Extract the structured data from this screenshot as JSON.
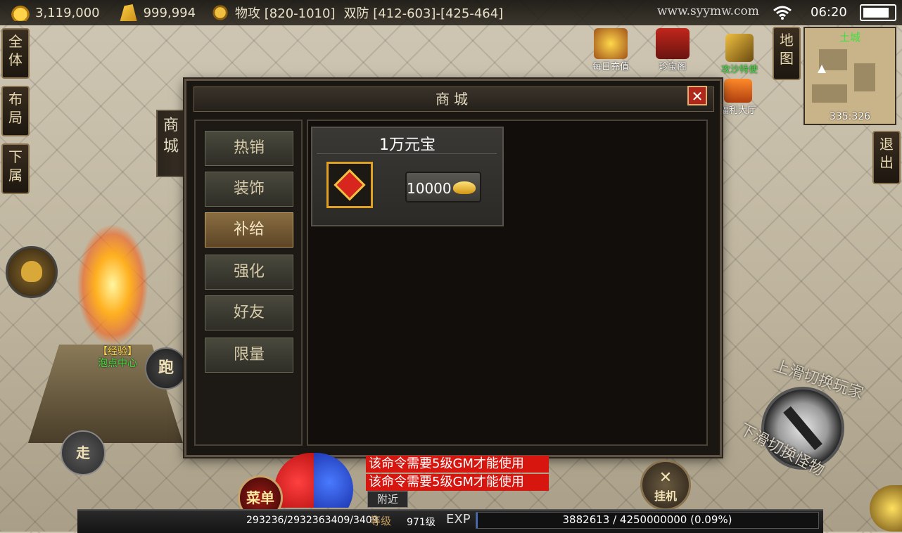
{
  "status_bar": {
    "gold": "3,119,000",
    "ingot": "999,994",
    "attack": "物攻 [820-1010]",
    "defense": "双防 [412-603]-[425-464]",
    "site": "www.syymw.com",
    "time": "06:20"
  },
  "left_buttons": {
    "all": "全体",
    "layout": "布局",
    "subordinate": "下属"
  },
  "events": {
    "daily_recharge": "每日充值",
    "treasure_pavilion": "珍宝阁",
    "welfare_hall": "福利大厅",
    "envoy": "攻沙特使"
  },
  "minimap": {
    "map_label": "地图",
    "area": "土城",
    "coords": "335:326"
  },
  "exit_label": "退出",
  "shop": {
    "title": "商城",
    "side_tab": "商城",
    "close": "✕",
    "categories": [
      "热销",
      "装饰",
      "补给",
      "强化",
      "好友",
      "限量"
    ],
    "active_category": "补给",
    "items": [
      {
        "name": "1万元宝",
        "price": "10000",
        "icon": "red-gem-icon"
      }
    ]
  },
  "world": {
    "exp_npc_line1": "【经验】",
    "exp_npc_line2": "泡点中心",
    "run": "跑",
    "walk": "走"
  },
  "chat": {
    "lines": [
      "该命令需要5级GM才能使用",
      "该命令需要5级GM才能使用"
    ],
    "channel": "附近"
  },
  "bottom": {
    "menu": "菜单",
    "hp_mp": "293236/2932363409/3409",
    "level_label": "等级",
    "level": "971级",
    "exp_label": "EXP",
    "exp_text": "3882613 / 4250000000 (0.09%)",
    "exp_fraction": 0.0009,
    "auto": "挂机"
  },
  "swipe_hints": {
    "up": "上滑切换玩家",
    "down": "下滑切换怪物"
  },
  "colors": {
    "chat_bg": "#d7160f",
    "active_tab": "#8a6e42",
    "minimap_area": "#3fe03f"
  }
}
